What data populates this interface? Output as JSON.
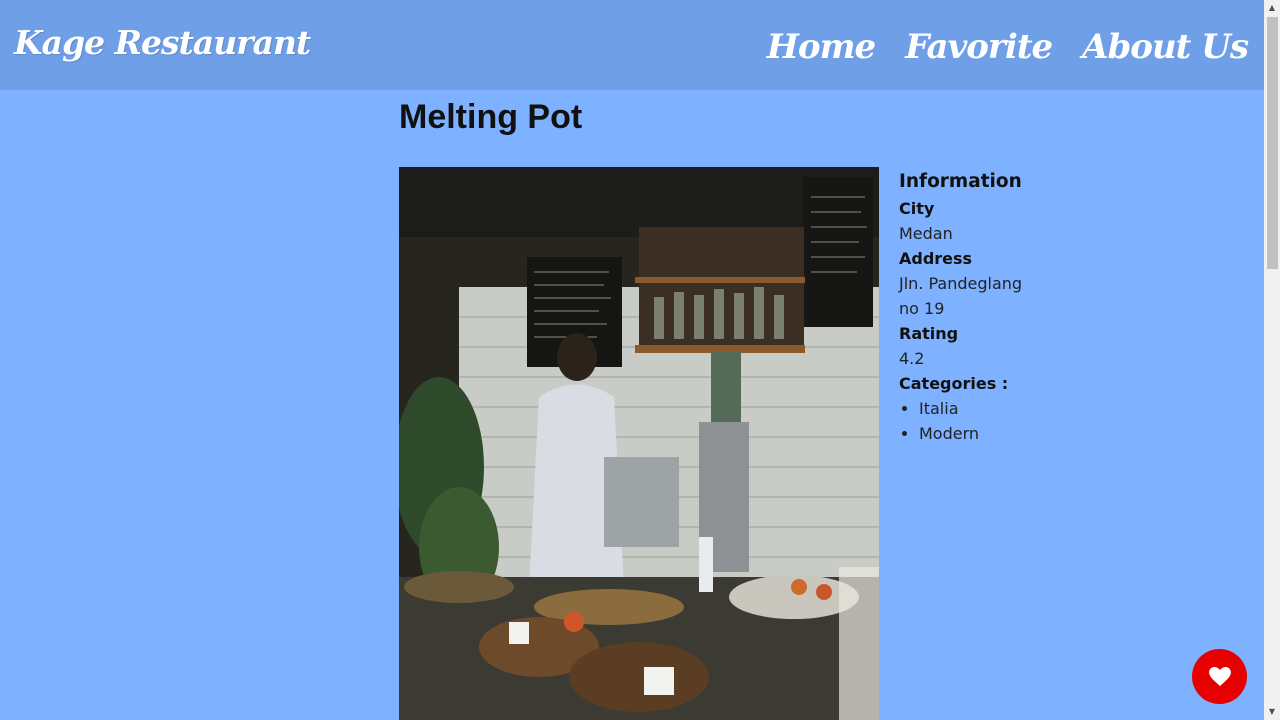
{
  "navbar": {
    "brand": "Kage Restaurant",
    "links": [
      "Home",
      "Favorite",
      "About Us"
    ]
  },
  "restaurant": {
    "name": "Melting Pot",
    "info_heading": "Information",
    "city_label": "City",
    "city": "Medan",
    "address_label": "Address",
    "address": "Jln. Pandeglang no 19",
    "rating_label": "Rating",
    "rating": "4.2",
    "categories_label": "Categories :",
    "categories": [
      "Italia",
      "Modern"
    ]
  },
  "favorite_button": {
    "icon": "heart-icon",
    "color": "#e60000"
  },
  "colors": {
    "page_background": "#7eb1ff",
    "navbar_background": "#6f9fe6"
  }
}
